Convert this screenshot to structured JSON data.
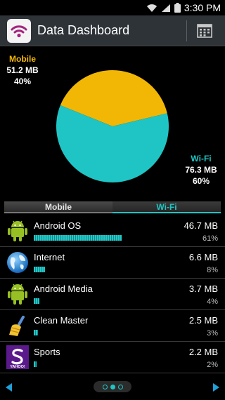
{
  "status_bar": {
    "time": "3:30 PM"
  },
  "header": {
    "title": "Data Dashboard"
  },
  "chart_data": {
    "type": "pie",
    "slices": [
      {
        "name": "Mobile",
        "value": 51.2,
        "label": "51.2 MB",
        "percent": "40%",
        "color": "#f2b705"
      },
      {
        "name": "Wi-Fi",
        "value": 76.3,
        "label": "76.3 MB",
        "percent": "60%",
        "color": "#1fc5c4"
      }
    ]
  },
  "tabs": [
    {
      "label": "Mobile",
      "selected": false
    },
    {
      "label": "Wi-Fi",
      "selected": true
    }
  ],
  "apps": [
    {
      "name": "Android OS",
      "size": "46.7 MB",
      "percent": "61%",
      "fraction": 0.61,
      "icon": "android-icon"
    },
    {
      "name": "Internet",
      "size": "6.6 MB",
      "percent": "8%",
      "fraction": 0.08,
      "icon": "globe-icon"
    },
    {
      "name": "Android Media",
      "size": "3.7 MB",
      "percent": "4%",
      "fraction": 0.04,
      "icon": "android-icon"
    },
    {
      "name": "Clean Master",
      "size": "2.5 MB",
      "percent": "3%",
      "fraction": 0.03,
      "icon": "broom-icon"
    },
    {
      "name": "Sports",
      "size": "2.2 MB",
      "percent": "2%",
      "fraction": 0.02,
      "icon": "yahoo-sports-icon",
      "icon_text": "YAHOO!"
    }
  ],
  "pager": {
    "pages": 3,
    "current": 2
  },
  "colors": {
    "mobile": "#f2b705",
    "wifi": "#1fc5c4",
    "actionbar": "#2e3338"
  }
}
